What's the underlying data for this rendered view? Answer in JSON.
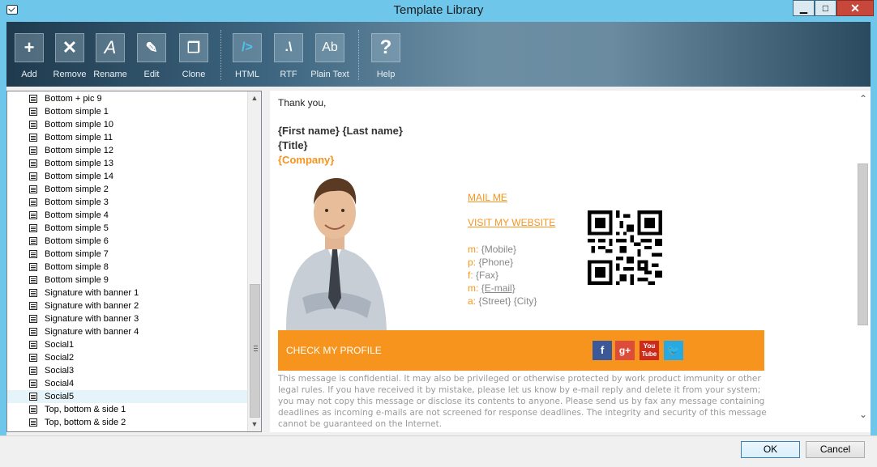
{
  "window": {
    "title": "Template Library",
    "minimize": "▁",
    "maximize": "□",
    "close": "✕"
  },
  "toolbar": [
    {
      "label": "Add",
      "icon": "plus-icon",
      "glyph": "+"
    },
    {
      "label": "Remove",
      "icon": "x-icon",
      "glyph": "✕"
    },
    {
      "label": "Rename",
      "icon": "rename-icon",
      "glyph": "A"
    },
    {
      "label": "Edit",
      "icon": "pencil-icon",
      "glyph": "✎"
    },
    {
      "label": "Clone",
      "icon": "clone-icon",
      "glyph": "❐"
    },
    {
      "label": "HTML",
      "icon": "html-icon",
      "glyph": "/>"
    },
    {
      "label": "RTF",
      "icon": "rtf-icon",
      "glyph": ".\\"
    },
    {
      "label": "Plain Text",
      "icon": "plain-text-icon",
      "glyph": "Ab"
    },
    {
      "label": "Help",
      "icon": "help-icon",
      "glyph": "?"
    }
  ],
  "templates": [
    "Bottom + pic 9",
    "Bottom simple 1",
    "Bottom simple 10",
    "Bottom simple 11",
    "Bottom simple 12",
    "Bottom simple 13",
    "Bottom simple 14",
    "Bottom simple 2",
    "Bottom simple 3",
    "Bottom simple 4",
    "Bottom simple 5",
    "Bottom simple 6",
    "Bottom simple 7",
    "Bottom simple 8",
    "Bottom simple 9",
    "Signature with banner 1",
    "Signature with banner 2",
    "Signature with banner 3",
    "Signature with banner 4",
    "Social1",
    "Social2",
    "Social3",
    "Social4",
    "Social5",
    "Top, bottom & side 1",
    "Top, bottom & side 2"
  ],
  "selected_template": "Social5",
  "preview": {
    "greeting": "Thank you,",
    "name": "{First name} {Last name}",
    "title": "{Title}",
    "company": "{Company}",
    "mail_link": "MAIL ME",
    "website_link": "VISIT MY WEBSITE",
    "contacts": [
      {
        "key": "m:",
        "value": "{Mobile}",
        "underline": false
      },
      {
        "key": "p:",
        "value": "{Phone}",
        "underline": false
      },
      {
        "key": "f:",
        "value": "{Fax}",
        "underline": false
      },
      {
        "key": "m:",
        "value": "{E-mail}",
        "underline": true
      },
      {
        "key": "a:",
        "value": "{Street} {City}",
        "underline": false
      }
    ],
    "banner_text": "CHECK MY PROFILE",
    "social": [
      {
        "name": "facebook-icon",
        "glyph": "f"
      },
      {
        "name": "google-plus-icon",
        "glyph": "g+"
      },
      {
        "name": "youtube-icon",
        "glyph": "You Tube"
      },
      {
        "name": "twitter-icon",
        "glyph": "🐦"
      }
    ],
    "disclaimer": "This message is confidential. It may also be privileged or otherwise protected by work product immunity or other legal rules. If you have received it by mistake, please let us know by e-mail reply and delete it from your system; you may not copy this message or disclose its contents to anyone. Please send us by fax any message containing deadlines as incoming e-mails are not screened for response deadlines. The integrity and security of this message cannot be guaranteed on the Internet.",
    "accent_color": "#f7941d"
  },
  "buttons": {
    "ok": "OK",
    "cancel": "Cancel"
  }
}
